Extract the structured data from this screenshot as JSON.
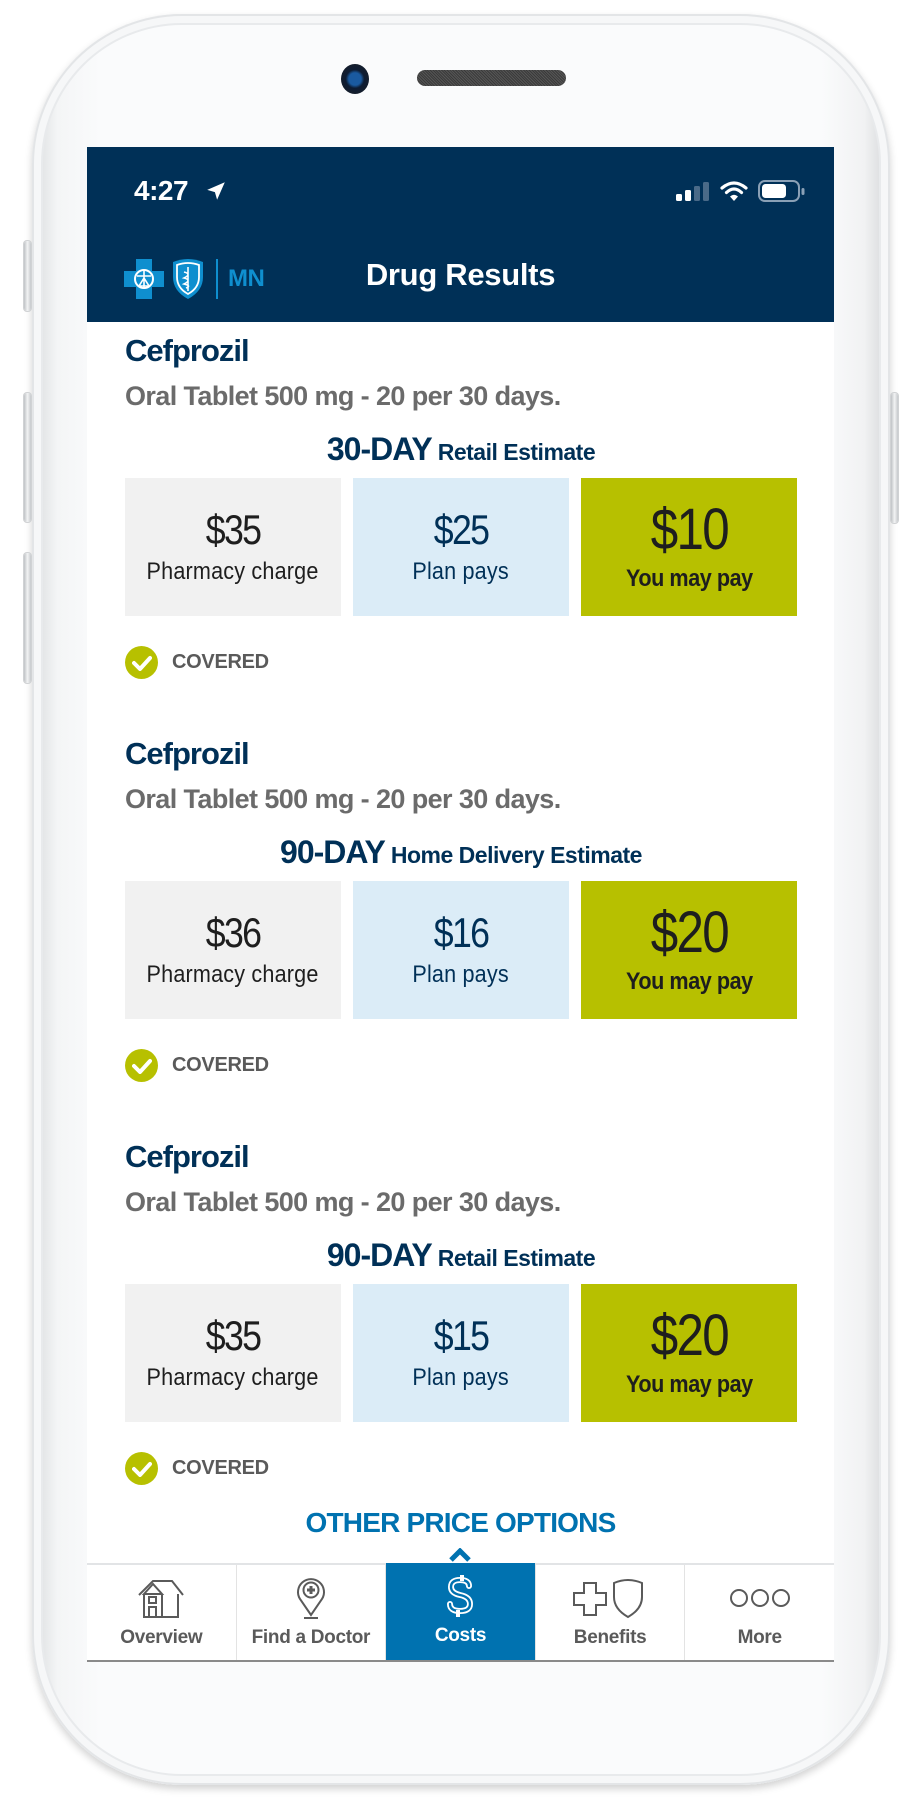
{
  "status_bar": {
    "time": "4:27",
    "location_icon": "location-arrow-icon",
    "signal_icon": "cellular-signal-icon",
    "wifi_icon": "wifi-icon",
    "battery_icon": "battery-icon"
  },
  "header": {
    "logo_state": "MN",
    "logo_icons": [
      "blue-cross-icon",
      "blue-shield-icon"
    ],
    "title": "Drug Results"
  },
  "results": [
    {
      "drug_name": "Cefprozil",
      "description": "Oral Tablet 500 mg - 20 per 30 days.",
      "estimate_days": "30-DAY",
      "estimate_type": "Retail Estimate",
      "pharmacy_charge": "$35",
      "pharmacy_label": "Pharmacy charge",
      "plan_pays": "$25",
      "plan_label": "Plan pays",
      "you_pay": "$10",
      "you_label": "You may pay",
      "coverage_status": "COVERED"
    },
    {
      "drug_name": "Cefprozil",
      "description": "Oral Tablet 500 mg - 20 per 30 days.",
      "estimate_days": "90-DAY",
      "estimate_type": "Home Delivery Estimate",
      "pharmacy_charge": "$36",
      "pharmacy_label": "Pharmacy charge",
      "plan_pays": "$16",
      "plan_label": "Plan pays",
      "you_pay": "$20",
      "you_label": "You may pay",
      "coverage_status": "COVERED"
    },
    {
      "drug_name": "Cefprozil",
      "description": "Oral Tablet 500 mg - 20 per 30 days.",
      "estimate_days": "90-DAY",
      "estimate_type": "Retail Estimate",
      "pharmacy_charge": "$35",
      "pharmacy_label": "Pharmacy charge",
      "plan_pays": "$15",
      "plan_label": "Plan pays",
      "you_pay": "$20",
      "you_label": "You may pay",
      "coverage_status": "COVERED"
    }
  ],
  "other_price_options": "OTHER PRICE OPTIONS",
  "tabbar": {
    "active": "Costs",
    "tabs": [
      {
        "label": "Overview",
        "icon": "house-icon"
      },
      {
        "label": "Find a Doctor",
        "icon": "map-pin-medical-icon"
      },
      {
        "label": "Costs",
        "icon": "dollar-icon"
      },
      {
        "label": "Benefits",
        "icon": "cross-shield-icon"
      },
      {
        "label": "More",
        "icon": "more-dots-icon"
      }
    ]
  },
  "colors": {
    "header_bg": "#003057",
    "brand_blue": "#0072b0",
    "logo_blue": "#0f8fcf",
    "you_pay_green": "#b7c000",
    "plan_pays_bg": "#dbecf7",
    "pharmacy_bg": "#f1f1f1"
  }
}
